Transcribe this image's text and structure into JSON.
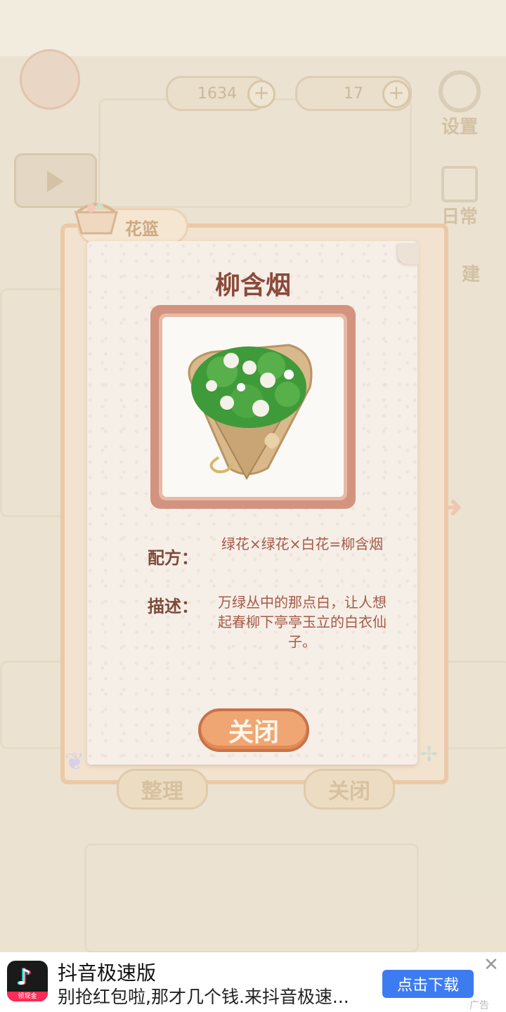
{
  "hud": {
    "fish_count": "1634",
    "cake_count": "17",
    "settings_label": "设置",
    "daily_label": "日常",
    "build_label": "建"
  },
  "basket": {
    "label": "花篮"
  },
  "card": {
    "title": "柳含烟",
    "recipe_label": "配方：",
    "recipe_value": "绿花×绿花×白花=柳含烟",
    "desc_label": "描述：",
    "desc_value": "万绿丛中的那点白，让人想起春柳下亭亭玉立的白衣仙子。",
    "close_button": "关闭"
  },
  "bottom_buttons": {
    "organize": "整理",
    "close": "关闭"
  },
  "ad": {
    "app_name": "抖音极速版",
    "subtitle": "别抢红包啦,那才几个钱.来抖音极速...",
    "badge": "领现金",
    "download_button": "点击下载",
    "close_symbol": "✕",
    "ad_tag": "广告"
  },
  "colors": {
    "title": "#8b4a3b",
    "label": "#7d4a3a",
    "value": "#a55a48",
    "close_button": "#efa672",
    "ad_button": "#3d7cf0"
  }
}
